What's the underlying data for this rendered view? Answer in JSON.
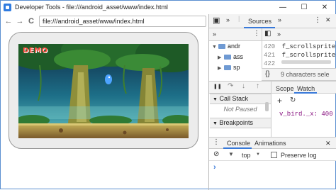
{
  "window": {
    "title": "Developer Tools - file:///android_asset/www/index.html",
    "controls": {
      "minimize": "—",
      "maximize": "☐",
      "close": "✕"
    }
  },
  "browser": {
    "back_glyph": "←",
    "forward_glyph": "→",
    "reload_glyph": "C",
    "url": "file:///android_asset/www/index.html"
  },
  "game": {
    "logo_text": "DEMO"
  },
  "devtools": {
    "top_tabs": {
      "more_left": "»",
      "sources": "Sources",
      "more_right": "»",
      "menu": "⋮",
      "close": "✕"
    },
    "navigator": {
      "items": [
        {
          "label": "andr",
          "indent": 1
        },
        {
          "label": "ass",
          "indent": 2
        },
        {
          "label": "sp",
          "indent": 2
        }
      ]
    },
    "editor": {
      "lines": [
        {
          "num": "420",
          "code": "f_scrollsprite"
        },
        {
          "num": "421",
          "code": "f_scrollsprite"
        },
        {
          "num": "422",
          "code": ""
        }
      ],
      "status": "9 characters sele"
    },
    "debugger": {
      "pause_glyph": "❚❚",
      "call_stack_label": "Call Stack",
      "not_paused": "Not Paused",
      "breakpoints_label": "Breakpoints"
    },
    "watch": {
      "tab_scope": "Scope",
      "tab_watch": "Watch",
      "add_glyph": "+",
      "refresh_glyph": "↻",
      "expression": "v_bird._x: 400"
    },
    "console": {
      "tab_console": "Console",
      "tab_animations": "Animations",
      "context": "top",
      "preserve_log": "Preserve log",
      "prompt": "›"
    }
  }
}
